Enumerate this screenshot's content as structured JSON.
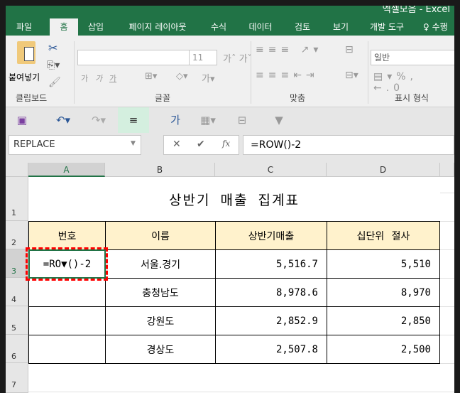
{
  "window": {
    "title": "엑셀모음 - Excel"
  },
  "tabs": [
    "파일",
    "홈",
    "삽입",
    "페이지 레이아웃",
    "수식",
    "데이터",
    "검토",
    "보기",
    "개발 도구",
    "수행"
  ],
  "ribbon": {
    "paste": "붙여넣기",
    "font_size": "11",
    "number_format": "일반",
    "groups": [
      "클립보드",
      "글꼴",
      "맞춤",
      "표시 형식"
    ],
    "font_buttons": [
      "가",
      "가",
      "가"
    ]
  },
  "formula_bar": {
    "name_box": "REPLACE",
    "formula": "=ROW()-2",
    "cancel": "✕",
    "enter": "✔",
    "fx": "fx"
  },
  "columns": [
    "A",
    "B",
    "C",
    "D"
  ],
  "rows": [
    "1",
    "2",
    "3",
    "4",
    "5",
    "6",
    "7"
  ],
  "sheet": {
    "title": "상반기 매출 집계표",
    "headers": [
      "번호",
      "이름",
      "상반기매출",
      "십단위 절사"
    ],
    "data": [
      {
        "no": "=RO▼()-2",
        "name": "서울.경기",
        "sales": "5,516.7",
        "trunc": "5,510"
      },
      {
        "no": "",
        "name": "충청남도",
        "sales": "8,978.6",
        "trunc": "8,970"
      },
      {
        "no": "",
        "name": "강원도",
        "sales": "2,852.9",
        "trunc": "2,850"
      },
      {
        "no": "",
        "name": "경상도",
        "sales": "2,507.8",
        "trunc": "2,500"
      }
    ]
  },
  "colors": {
    "accent": "#217346",
    "header_fill": "#fff2cc",
    "highlight": "#ff0000"
  }
}
